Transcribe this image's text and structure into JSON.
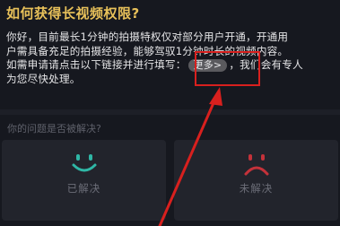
{
  "header": {
    "title": "如何获得长视频权限?"
  },
  "body": {
    "line1": "你好，目前最长1分钟的拍摄特权仅对部分用户开通，开通用",
    "line2": "户需具备充足的拍摄经验，能够驾驭1分钟时长的视频内容。",
    "line3_prefix": "如需申请请点击以下链接并进行填写：",
    "more_link": "更多>",
    "line3_suffix": "，我们会有专人",
    "line4": "为您尽快处理。"
  },
  "feedback": {
    "question": "你的问题是否被解决?",
    "resolved_label": "已解决",
    "unresolved_label": "未解决",
    "resolved_icon": "smile-face-icon",
    "unresolved_icon": "sad-face-icon",
    "resolved_color": "#2fb7a6",
    "unresolved_color": "#c4323a"
  },
  "annotation": {
    "color": "#d8201e"
  }
}
